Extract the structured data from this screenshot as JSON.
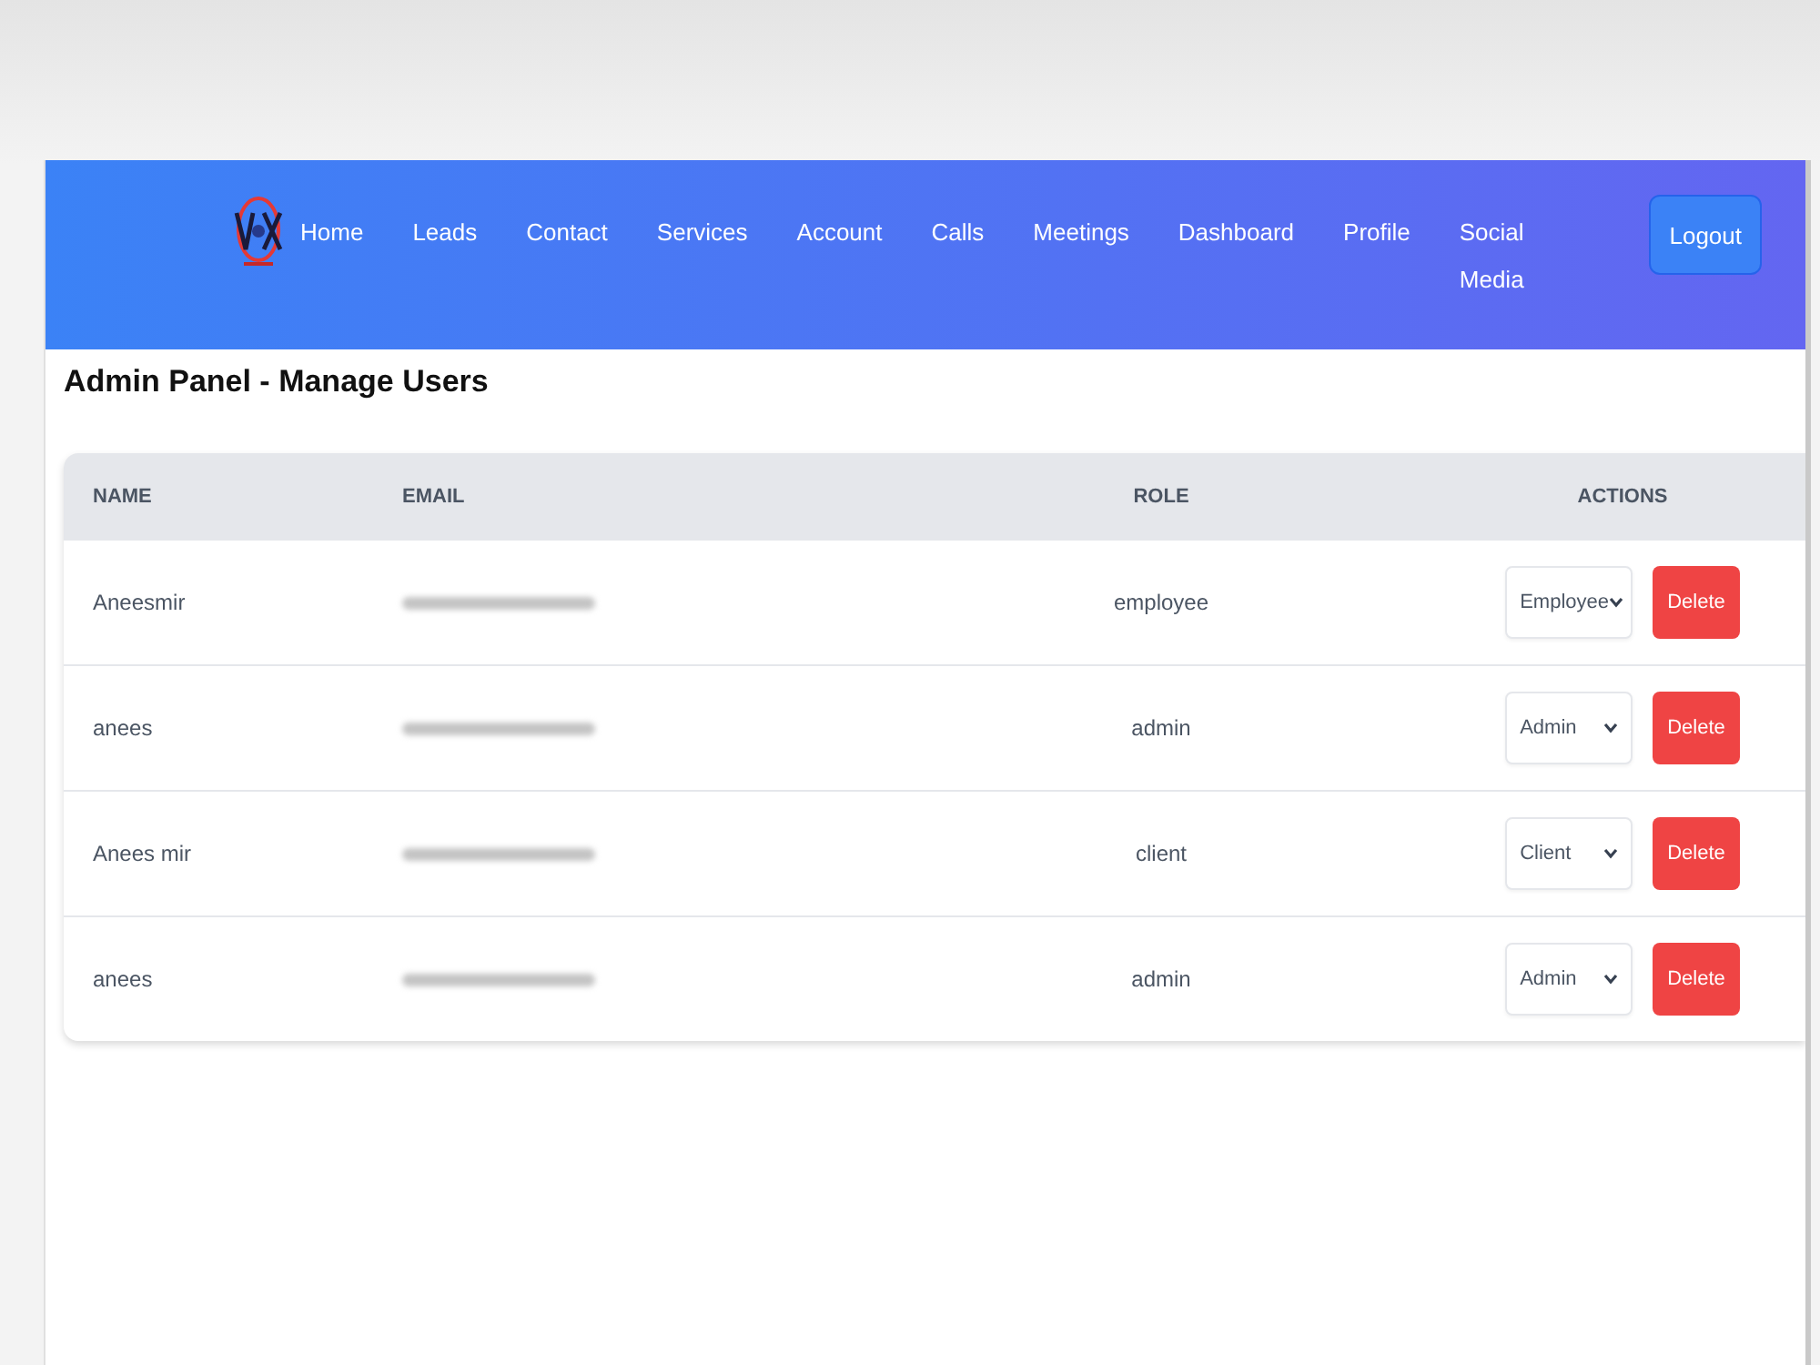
{
  "navbar": {
    "links": [
      "Home",
      "Leads",
      "Contact",
      "Services",
      "Account",
      "Calls",
      "Meetings",
      "Dashboard",
      "Profile",
      "Social Media"
    ],
    "logout": "Logout"
  },
  "page_title": "Admin Panel - Manage Users",
  "table": {
    "columns": [
      "NAME",
      "EMAIL",
      "ROLE",
      "ACTIONS"
    ],
    "rows": [
      {
        "name": "Aneesmir",
        "role": "employee",
        "role_choice": "Employee",
        "action": "Delete"
      },
      {
        "name": "anees",
        "role": "admin",
        "role_choice": "Admin",
        "action": "Delete"
      },
      {
        "name": "Anees mir",
        "role": "client",
        "role_choice": "Client",
        "action": "Delete"
      },
      {
        "name": "anees",
        "role": "admin",
        "role_choice": "Admin",
        "action": "Delete"
      }
    ]
  }
}
